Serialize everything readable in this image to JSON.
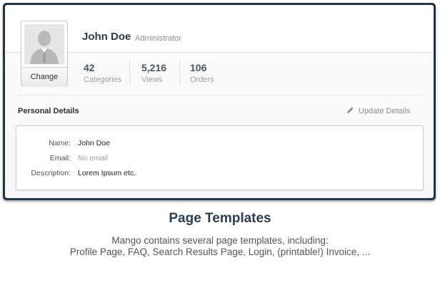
{
  "profile": {
    "name": "John Doe",
    "role": "Administrator",
    "change_label": "Change"
  },
  "stats": [
    {
      "value": "42",
      "label": "Categories"
    },
    {
      "value": "5,216",
      "label": "Views"
    },
    {
      "value": "106",
      "label": "Orders"
    }
  ],
  "personal_details": {
    "title": "Personal Details",
    "update_label": "Update Details",
    "rows": [
      {
        "label": "Name:",
        "value": "John Doe"
      },
      {
        "label": "Email:",
        "value": "No email"
      },
      {
        "label": "Description:",
        "value": "Lorem Ipsum etc."
      }
    ]
  },
  "caption": {
    "heading": "Page Templates",
    "line1": "Mango contains several page templates, including:",
    "line2": "Profile Page, FAQ, Search Results Page, Login, (printable!) Invoice, ..."
  },
  "colors": {
    "frame": "#233446",
    "heading": "#2d3e50"
  },
  "icons": [
    "user-silhouette-icon",
    "pencil-icon"
  ]
}
